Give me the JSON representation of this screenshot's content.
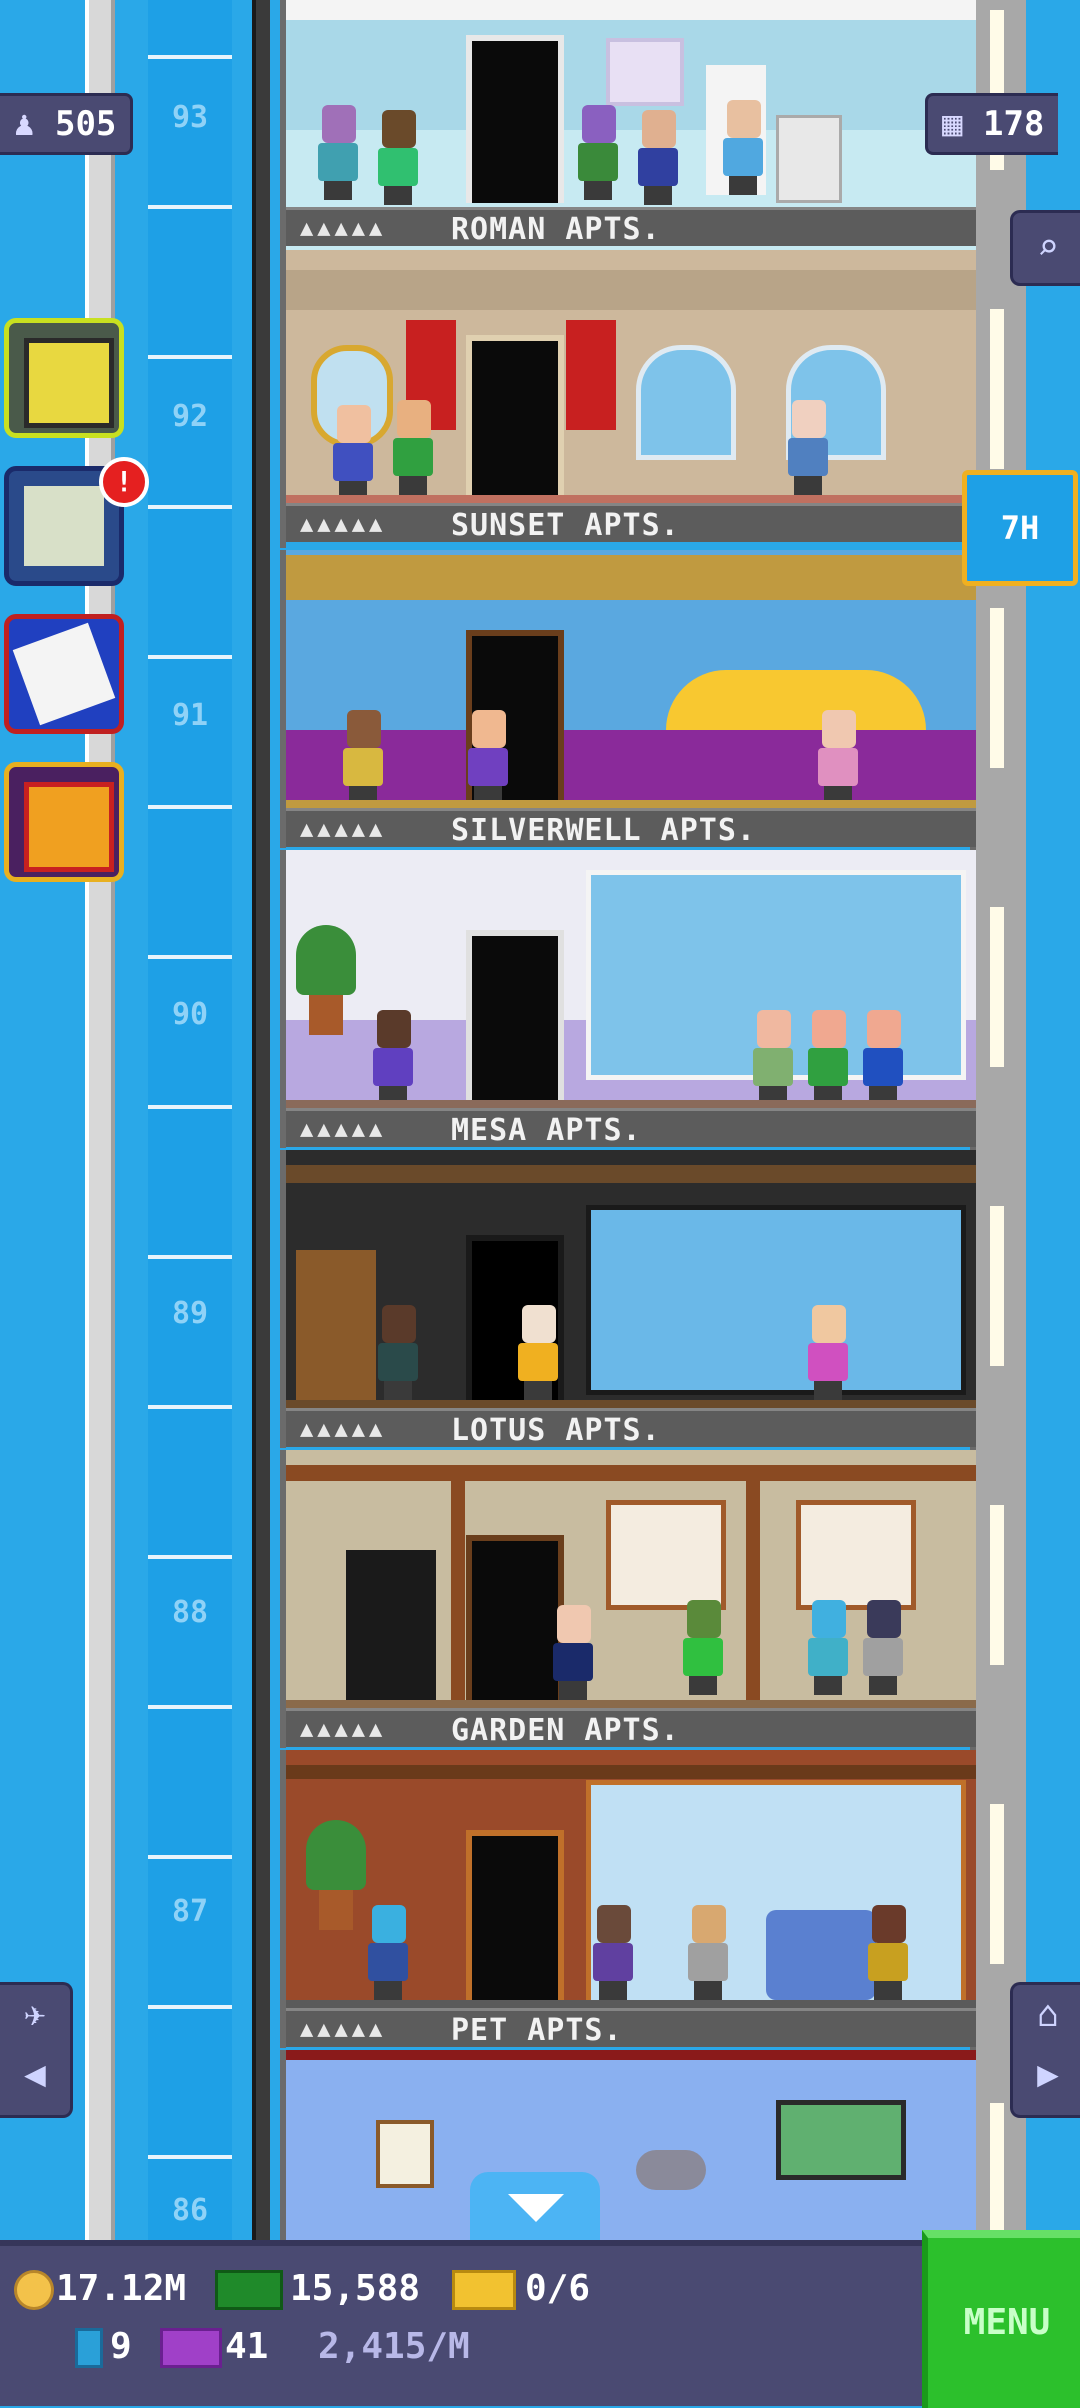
{
  "hud_top": {
    "population": "505",
    "floors_count": "178"
  },
  "floor_numbers": [
    "93",
    "92",
    "91",
    "90",
    "89",
    "88",
    "87",
    "86"
  ],
  "floors": [
    {
      "label_dots": "▲▲▲▲▲",
      "name": "ROMAN APTS."
    },
    {
      "label_dots": "▲▲▲▲▲",
      "name": "SUNSET APTS."
    },
    {
      "label_dots": "▲▲▲▲▲",
      "name": "SILVERWELL APTS."
    },
    {
      "label_dots": "▲▲▲▲▲",
      "name": "MESA APTS."
    },
    {
      "label_dots": "▲▲▲▲▲",
      "name": "LOTUS APTS."
    },
    {
      "label_dots": "▲▲▲▲▲",
      "name": "GARDEN APTS."
    },
    {
      "label_dots": "▲▲▲▲▲",
      "name": "PET APTS."
    }
  ],
  "side_buttons": {
    "build_icon": "building-icon",
    "missions_icon": "checklist-icon",
    "missions_badge": "!",
    "calendar_icon": "calendar-icon",
    "gift_icon": "gift-icon"
  },
  "hours_button": "7H",
  "nav": {
    "left_icon": "airplane-icon",
    "left_arrow": "◀",
    "right_icon": "home-icon",
    "right_arrow": "▶",
    "search_icon": "magnifier-icon",
    "down_arrow": "▼"
  },
  "hud_bottom": {
    "coins": "17.12M",
    "bux": "15,588",
    "tickets": "0/6",
    "bux_small": "9",
    "vip": "41",
    "rate": "2,415/M",
    "menu_label": "MENU"
  },
  "colors": {
    "sky": "#2aa8e8",
    "hud": "#4a4a72",
    "menu": "#2cc02c",
    "nameplate": "#5c5c5c"
  }
}
